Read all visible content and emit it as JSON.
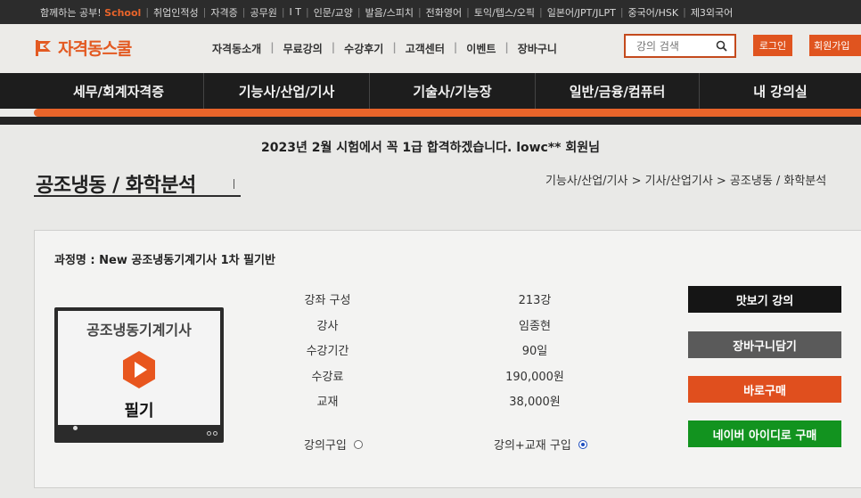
{
  "topbar": {
    "items": [
      "함께하는 공부!",
      "취업인적성",
      "자격증",
      "공무원",
      "I T",
      "인문/교양",
      "발음/스피치",
      "전화영어",
      "토익/텝스/오픽",
      "일본어/JPT/JLPT",
      "중국어/HSK",
      "제3외국어"
    ],
    "brand_mini": "School"
  },
  "header": {
    "logo_text": "자격동스쿨",
    "gnb": [
      "자격동소개",
      "무료강의",
      "수강후기",
      "고객센터",
      "이벤트",
      "장바구니"
    ],
    "search_placeholder": "강의 검색",
    "login_label": "로그인",
    "join_label": "회원가입"
  },
  "categories": [
    "세무/회계자격증",
    "기능사/산업/기사",
    "기술사/기능장",
    "일반/금융/컴퓨터",
    "내 강의실"
  ],
  "review_text": "2023년 2월 시험에서 꼭 1급 합격하겠습니다. lowc** 회원님",
  "page_title": "공조냉동 / 화학분석",
  "breadcrumb": "기능사/산업/기사 > 기사/산업기사 > 공조냉동 / 화학분석",
  "course": {
    "name": "과정명 : New 공조냉동기계기사 1차 필기반",
    "thumb_title": "공조냉동기계기사",
    "thumb_sub": "필기",
    "info": [
      {
        "label": "강좌 구성",
        "value": "213강"
      },
      {
        "label": "강사",
        "value": "임종현"
      },
      {
        "label": "수강기간",
        "value": "90일"
      },
      {
        "label": "수강료",
        "value": "190,000원"
      },
      {
        "label": "교재",
        "value": "38,000원"
      }
    ],
    "option_lecture": "강의구입",
    "option_lecture_book": "강의+교재 구입",
    "selected_option": "lecture_book"
  },
  "actions": {
    "preview": "맛보기 강의",
    "cart": "장바구니담기",
    "buy": "바로구매",
    "naver": "네이버 아이디로 구매"
  },
  "colors": {
    "accent": "#e0541f",
    "dark": "#1d1d1d",
    "naver": "#12931f"
  }
}
